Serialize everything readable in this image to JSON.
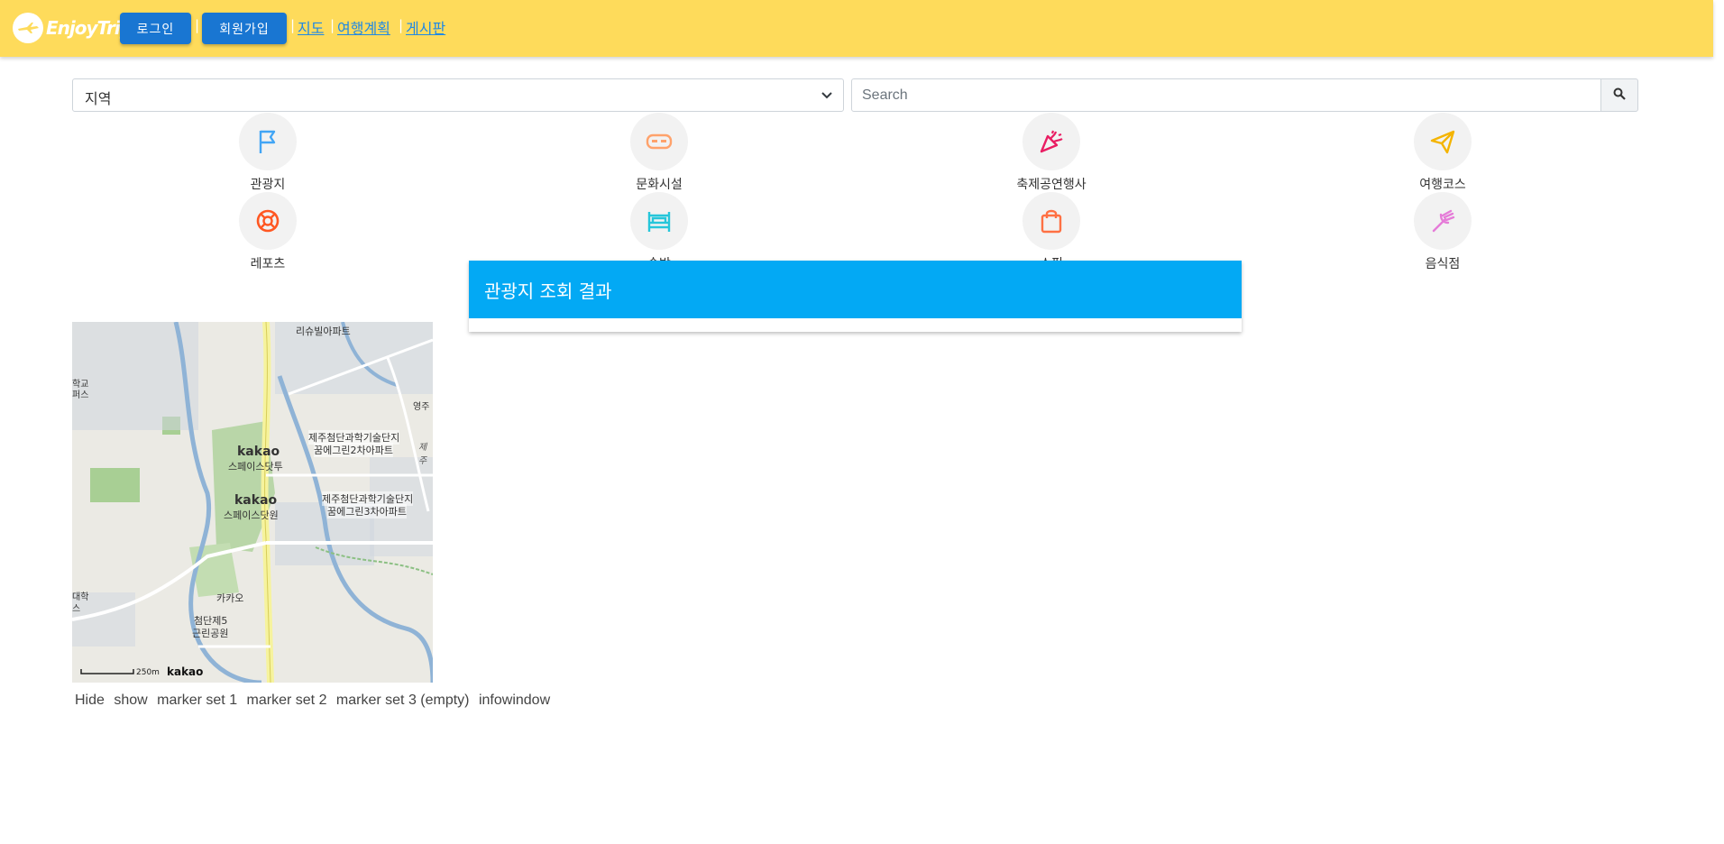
{
  "header": {
    "logo_text": "EnjoyTrip.",
    "login_label": "로그인",
    "signup_label": "회원가입",
    "separator": "|",
    "nav": [
      "지도",
      "여행계획",
      "게시판"
    ],
    "bg_color": "#fedb5b",
    "button_color": "#1976d2",
    "link_color": "#1e88e5"
  },
  "search": {
    "region_value": "지역",
    "placeholder": "Search"
  },
  "categories": [
    {
      "label": "관광지",
      "icon": "flag-icon",
      "color": "#42a5f5"
    },
    {
      "label": "문화시설",
      "icon": "mask-icon",
      "color": "#ffa26b"
    },
    {
      "label": "축제공연행사",
      "icon": "party-popper-icon",
      "color": "#e91e63"
    },
    {
      "label": "여행코스",
      "icon": "paper-plane-icon",
      "color": "#f4b400"
    },
    {
      "label": "레포츠",
      "icon": "lifebuoy-icon",
      "color": "#ff5722"
    },
    {
      "label": "숙박",
      "icon": "bed-icon",
      "color": "#26c6da"
    },
    {
      "label": "쇼핑",
      "icon": "shopping-bag-icon",
      "color": "#ff7043"
    },
    {
      "label": "음식점",
      "icon": "fork-icon",
      "color": "#e57cd8"
    }
  ],
  "result": {
    "title": "관광지 조회 결과",
    "header_color": "#03a9f4"
  },
  "map": {
    "labels": {
      "apt1": "리슈빌아파트",
      "campus1": "학교",
      "campus2": "퍼스",
      "apt2_l1": "제주첨단과학기술단지",
      "apt2_l2": "꿈에그린2차아파트",
      "apt3_l1": "제주첨단과학기술단지",
      "apt3_l2": "꿈에그린3차아파트",
      "kakao1": "kakao",
      "space1": "스페이스닷투",
      "kakao2": "kakao",
      "space2": "스페이스닷원",
      "kakao_kr": "카카오",
      "park_l1": "첨단제5",
      "park_l2": "근린공원",
      "univ1": "대학",
      "univ2": "스",
      "young": "영주",
      "je": "제주",
      "scale": "250m",
      "brand": "kakao"
    }
  },
  "map_controls": [
    "Hide",
    "show",
    "marker set 1",
    "marker set 2",
    "marker set 3 (empty)",
    "infowindow"
  ]
}
